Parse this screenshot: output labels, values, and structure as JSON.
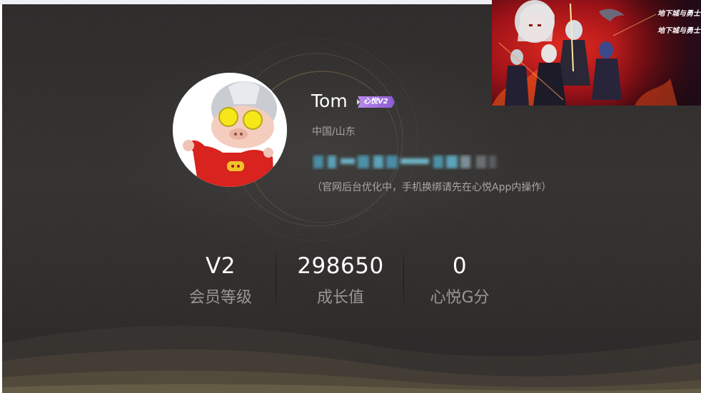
{
  "profile": {
    "username": "Tom",
    "vip_badge": "心悦V2",
    "location": "中国/山东",
    "notice": "（官网后台优化中，手机换绑请先在心悦App内操作）"
  },
  "stats": [
    {
      "value": "V2",
      "label": "会员等级"
    },
    {
      "value": "298650",
      "label": "成长值"
    },
    {
      "value": "0",
      "label": "心悦G分"
    }
  ],
  "banner": {
    "logo_text": "地下城与勇士"
  },
  "colors": {
    "panel_bg": "#333130",
    "badge_purple": "#9b6bd8",
    "avatar_suit_red": "#d8231e",
    "banner_red": "#b2161c"
  }
}
